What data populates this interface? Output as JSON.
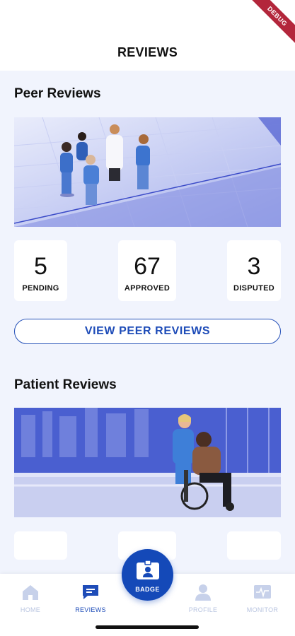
{
  "header": {
    "title": "REVIEWS",
    "debug_banner": "DEBUG"
  },
  "peer_reviews": {
    "title": "Peer Reviews",
    "stats": [
      {
        "value": "5",
        "label": "PENDING"
      },
      {
        "value": "67",
        "label": "APPROVED"
      },
      {
        "value": "3",
        "label": "DISPUTED"
      }
    ],
    "button_label": "VIEW PEER REVIEWS"
  },
  "patient_reviews": {
    "title": "Patient Reviews"
  },
  "bottom_nav": {
    "items": [
      {
        "label": "HOME",
        "icon": "home-icon"
      },
      {
        "label": "REVIEWS",
        "icon": "reviews-icon"
      },
      {
        "label": "PROFILE",
        "icon": "profile-icon"
      },
      {
        "label": "MONITOR",
        "icon": "monitor-icon"
      }
    ],
    "badge": {
      "label": "BADGE",
      "icon": "badge-icon"
    },
    "active": "REVIEWS"
  },
  "colors": {
    "accent": "#1449b8",
    "background": "#f1f4fd",
    "inactive": "#b8c4e0"
  }
}
